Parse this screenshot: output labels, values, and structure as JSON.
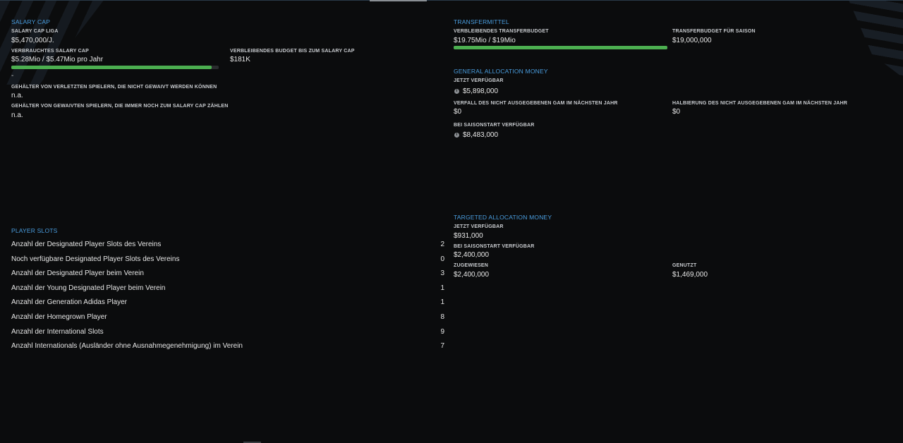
{
  "salary_cap": {
    "title": "SALARY CAP",
    "liga_label": "SALARY CAP LIGA",
    "liga_value": "$5,470,000/J.",
    "used_label": "VERBRAUCHTES SALARY CAP",
    "used_value": "$5.28Mio / $5.47Mio pro Jahr",
    "used_fraction": 0.965,
    "remaining_label": "VERBLEIBENDES BUDGET BIS ZUM SALARY CAP",
    "remaining_value": "$181K",
    "dash": "-",
    "injured_label": "GEHÄLTER VON VERLETZTEN SPIELERN, DIE NICHT GEWAIVT WERDEN KÖNNEN",
    "injured_value": "n.a.",
    "waived_label": "GEHÄLTER VON GEWAIVTEN SPIELERN, DIE IMMER NOCH ZUM SALARY CAP ZÄHLEN",
    "waived_value": "n.a."
  },
  "transfer": {
    "title": "TRANSFERMITTEL",
    "remaining_label": "VERBLEIBENDES TRANSFERBUDGET",
    "remaining_value": "$19.75Mio / $19Mio",
    "remaining_fraction": 1.0,
    "season_label": "TRANSFERBUDGET FÜR SAISON",
    "season_value": "$19,000,000"
  },
  "gam": {
    "title": "GENERAL ALLOCATION MONEY",
    "now_label": "JETZT VERFÜGBAR",
    "now_value": "$5,898,000",
    "expire_label": "VERFALL DES NICHT AUSGEGEBENEN GAM IM NÄCHSTEN JAHR",
    "expire_value": "$0",
    "halve_label": "HALBIERUNG DES NICHT AUSGEGEBENEN GAM IM NÄCHSTEN JAHR",
    "halve_value": "$0",
    "season_start_label": "BEI SAISONSTART VERFÜGBAR",
    "season_start_value": "$8,483,000"
  },
  "tam": {
    "title": "TARGETED ALLOCATION MONEY",
    "now_label": "JETZT VERFÜGBAR",
    "now_value": "$931,000",
    "season_start_label": "BEI SAISONSTART VERFÜGBAR",
    "season_start_value": "$2,400,000",
    "assigned_label": "ZUGEWIESEN",
    "assigned_value": "$2,400,000",
    "used_label": "GENUTZT",
    "used_value": "$1,469,000"
  },
  "player_slots": {
    "title": "PLAYER SLOTS",
    "rows": [
      {
        "label": "Anzahl der Designated Player Slots des Vereins",
        "value": "2"
      },
      {
        "label": "Noch verfügbare Designated Player Slots des Vereins",
        "value": "0"
      },
      {
        "label": "Anzahl der Designated Player beim Verein",
        "value": "3"
      },
      {
        "label": "Anzahl der Young Designated Player beim Verein",
        "value": "1"
      },
      {
        "label": "Anzahl der Generation Adidas Player",
        "value": "1"
      },
      {
        "label": "Anzahl der Homegrown Player",
        "value": "8"
      },
      {
        "label": "Anzahl der International Slots",
        "value": "9"
      },
      {
        "label": "Anzahl Internationals (Ausländer ohne Ausnahmegenehmigung) im Verein",
        "value": "7"
      }
    ]
  },
  "icons": {
    "info": "i"
  },
  "colors": {
    "accent_blue": "#4a9ee0",
    "bar_green": "#4caf50",
    "background": "#0b0c0d"
  }
}
